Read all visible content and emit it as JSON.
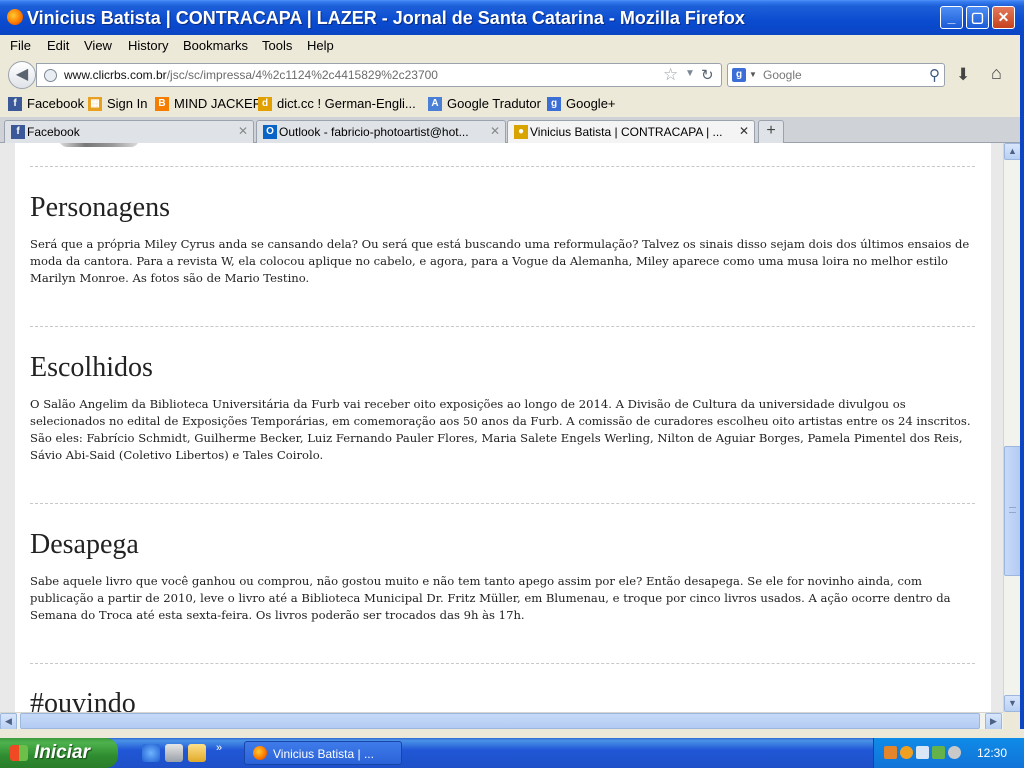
{
  "window": {
    "title": "Vinicius Batista | CONTRACAPA | LAZER - Jornal de Santa Catarina - Mozilla Firefox"
  },
  "menu": [
    "File",
    "Edit",
    "View",
    "History",
    "Bookmarks",
    "Tools",
    "Help"
  ],
  "nav": {
    "url_host": "www.clicrbs.com.br",
    "url_path": "/jsc/sc/impressa/4%2c1124%2c4415829%2c23700",
    "search_placeholder": "Google"
  },
  "bookmarks": [
    {
      "label": "Facebook",
      "icon": "facebook-icon",
      "color": "#3b5998",
      "glyph": "f"
    },
    {
      "label": "Sign In",
      "icon": "windows-icon",
      "color": "#e8a020",
      "glyph": "▦"
    },
    {
      "label": "MIND JACKER",
      "icon": "blogger-icon",
      "color": "#f57d00",
      "glyph": "B"
    },
    {
      "label": "dict.cc ! German-Engli...",
      "icon": "dictcc-icon",
      "color": "#e2a000",
      "glyph": "d"
    },
    {
      "label": "Google Tradutor",
      "icon": "translate-icon",
      "color": "#4a7fd6",
      "glyph": "A"
    },
    {
      "label": "Google+",
      "icon": "google-icon",
      "color": "#3c6fd6",
      "glyph": "g"
    }
  ],
  "tabs": [
    {
      "label": "Facebook",
      "icon": "facebook-icon",
      "color": "#3b5998",
      "glyph": "f",
      "active": false
    },
    {
      "label": "Outlook - fabricio-photoartist@hot...",
      "icon": "outlook-icon",
      "color": "#0a64c8",
      "glyph": "O",
      "active": false
    },
    {
      "label": "Vinicius Batista | CONTRACAPA | ...",
      "icon": "site-icon",
      "color": "#d9a400",
      "glyph": "●",
      "active": true
    }
  ],
  "articles": [
    {
      "title": "Personagens",
      "body": "Será que a própria Miley Cyrus anda se cansando dela? Ou será que está buscando uma reformulação? Talvez os sinais disso sejam dois dos últimos ensaios de moda da cantora. Para a revista W, ela colocou aplique no cabelo, e agora, para a Vogue da Alemanha, Miley aparece como uma musa loira no melhor estilo Marilyn Monroe. As fotos são de Mario Testino."
    },
    {
      "title": "Escolhidos",
      "body": "O Salão Angelim da Biblioteca Universitária da Furb vai receber oito exposições ao longo de 2014. A Divisão de Cultura da universidade divulgou os selecionados no edital de Exposições Temporárias, em comemoração aos 50 anos da Furb. A comissão de curadores escolheu oito artistas entre os 24 inscritos. São eles: Fabrício Schmidt, Guilherme Becker, Luiz Fernando Pauler Flores, Maria Salete Engels Werling, Nilton de Aguiar Borges, Pamela Pimentel dos Reis, Sávio Abi-Said (Coletivo Libertos) e Tales Coirolo."
    },
    {
      "title": "Desapega",
      "body": "Sabe aquele livro que você ganhou ou comprou, não gostou muito e não tem tanto apego assim por ele? Então desapega. Se ele for novinho ainda, com publicação a partir de 2010, leve o livro até a Biblioteca Municipal Dr. Fritz Müller, em Blumenau, e troque por cinco livros usados. A ação ocorre dentro da Semana do Troca até esta sexta-feira. Os livros poderão ser trocados das 9h às 17h."
    },
    {
      "title": "#ouvindo",
      "body": ""
    }
  ],
  "taskbar": {
    "start_label": "Iniciar",
    "task_label": "Vinicius Batista | ...",
    "clock": "12:30"
  }
}
